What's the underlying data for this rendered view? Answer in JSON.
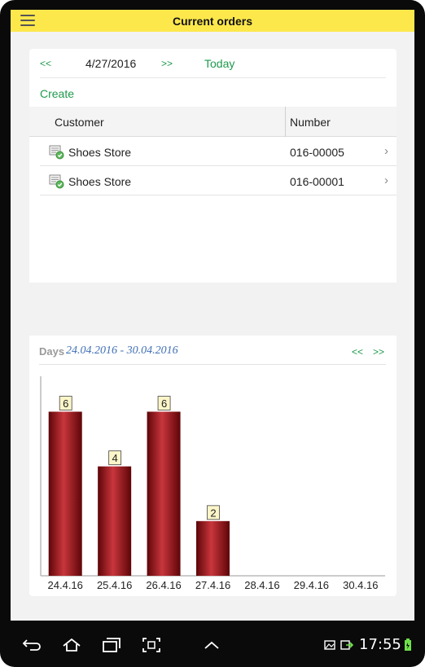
{
  "app": {
    "title": "Current orders"
  },
  "datebar": {
    "prev_label": "<<",
    "date": "4/27/2016",
    "next_label": ">>",
    "today_label": "Today"
  },
  "actions": {
    "create_label": "Create"
  },
  "table": {
    "columns": [
      "Customer",
      "Number"
    ],
    "rows": [
      {
        "customer": "Shoes Store",
        "number": "016-00005"
      },
      {
        "customer": "Shoes Store",
        "number": "016-00001"
      }
    ]
  },
  "chart_header": {
    "days_label": "Days",
    "range": "24.04.2016 - 30.04.2016",
    "prev_label": "<<",
    "next_label": ">>"
  },
  "chart_data": {
    "type": "bar",
    "title": "",
    "xlabel": "",
    "ylabel": "",
    "categories": [
      "24.4.16",
      "25.4.16",
      "26.4.16",
      "27.4.16",
      "28.4.16",
      "29.4.16",
      "30.4.16"
    ],
    "values": [
      6,
      4,
      6,
      2,
      0,
      0,
      0
    ],
    "ylim": [
      0,
      7.5
    ],
    "data_labels": true,
    "grid": false,
    "bar_color": "#8b0d10"
  },
  "status": {
    "time": "17:55"
  },
  "colors": {
    "accent_green": "#1e9a4c",
    "titlebar_yellow": "#fde84c",
    "range_blue": "#3f6fb5"
  },
  "icons": {
    "menu": "hamburger-icon",
    "row_doc": "document-check-icon",
    "row_chevron": "chevron-right-icon",
    "back": "back-icon",
    "home": "home-icon",
    "recent": "recent-apps-icon",
    "screenshot": "screenshot-icon",
    "up": "chevron-up-icon",
    "gallery": "gallery-icon",
    "export": "export-icon",
    "battery": "battery-icon"
  }
}
